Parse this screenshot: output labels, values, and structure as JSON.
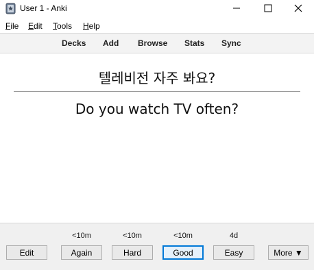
{
  "window": {
    "title": "User 1 - Anki"
  },
  "menu": [
    {
      "label": "File",
      "accel": "F",
      "rest": "ile"
    },
    {
      "label": "Edit",
      "accel": "E",
      "rest": "dit"
    },
    {
      "label": "Tools",
      "accel": "T",
      "rest": "ools"
    },
    {
      "label": "Help",
      "accel": "H",
      "rest": "elp"
    }
  ],
  "toolbar": {
    "decks": "Decks",
    "add": "Add",
    "browse": "Browse",
    "stats": "Stats",
    "sync": "Sync"
  },
  "card": {
    "front": "텔레비전 자주 봐요?",
    "back": "Do you watch TV often?"
  },
  "bottom": {
    "edit": "Edit",
    "answers": [
      {
        "interval": "<10m",
        "label": "Again"
      },
      {
        "interval": "<10m",
        "label": "Hard"
      },
      {
        "interval": "<10m",
        "label": "Good"
      },
      {
        "interval": "4d",
        "label": "Easy"
      }
    ],
    "more": "More ▼"
  }
}
